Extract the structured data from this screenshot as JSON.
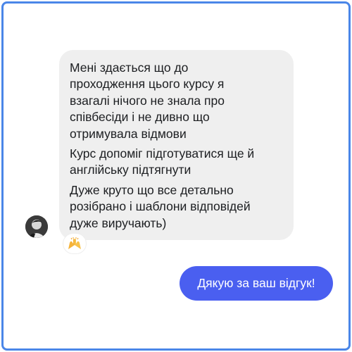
{
  "conversation": {
    "incoming": {
      "paragraphs": [
        "Мені здається що до\nпроходження цього курсу я\nвзагалі нічого не знала про\nспівбесіди і не дивно що\nотримувала відмови",
        "Курс допоміг підготуватися ще й\nанглійську підтягнути",
        "Дуже круто що все детально\nрозібрано і шаблони відповідей\nдуже виручають)"
      ],
      "reaction_icon": "raising-hands-emoji"
    },
    "outgoing": {
      "text": "Дякую за ваш відгук!"
    }
  },
  "colors": {
    "frame_border": "#4a86e8",
    "incoming_bubble": "#efefef",
    "outgoing_bubble": "#4a5ff0",
    "text_dark": "#1c1e21"
  }
}
